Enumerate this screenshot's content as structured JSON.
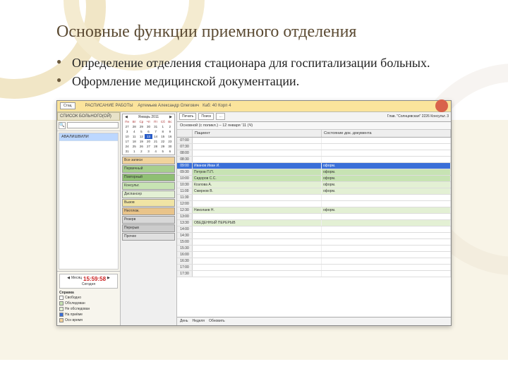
{
  "slide": {
    "title": "Основные функции приемного отделения",
    "bullets": [
      "Определение отделения стационара для госпитализации больных.",
      "Оформление медицинской документации."
    ]
  },
  "app": {
    "header": {
      "btn1": "Стац",
      "user_line1": "РАСПИСАНИЕ",
      "user_line2": "РАБОТЫ",
      "user_name": "Артемьев Александр Олегович",
      "user_id": "Каб: 40 Корп 4"
    },
    "left": {
      "panel_title": "СПИСОК БОЛЬНОГО(ОЙ)",
      "search_placeholder": "",
      "patient": "АВАЛИШВИЛИ",
      "clock_label": "Месяц",
      "clock_time": "15:59:58",
      "clock_day": "Сегодня",
      "legend_title": "Справка",
      "legend": [
        {
          "label": "Свободно",
          "color": "#ffffff"
        },
        {
          "label": "Обследован",
          "color": "#c7e3b3"
        },
        {
          "label": "Не обследован",
          "color": "#e3f0d4"
        },
        {
          "label": "На приёме",
          "color": "#3a6fd8"
        },
        {
          "label": "Осн время",
          "color": "#f6d39a"
        }
      ]
    },
    "calendar": {
      "month": "Январь 2011",
      "dow": [
        "Пн",
        "Вт",
        "Ср",
        "Чт",
        "Пт",
        "Сб",
        "Вс"
      ],
      "days": [
        "27",
        "28",
        "29",
        "30",
        "31",
        "1",
        "2",
        "3",
        "4",
        "5",
        "6",
        "7",
        "8",
        "9",
        "10",
        "11",
        "12",
        "13",
        "14",
        "15",
        "16",
        "17",
        "18",
        "19",
        "20",
        "21",
        "22",
        "23",
        "24",
        "25",
        "26",
        "27",
        "28",
        "29",
        "30",
        "31",
        "1",
        "2",
        "3",
        "4",
        "5",
        "6"
      ],
      "selected": "13"
    },
    "categories": [
      {
        "label": "Все записи",
        "color": "#f1d39c"
      },
      {
        "label": "Первичный",
        "color": "#a7cf8d"
      },
      {
        "label": "Повторный",
        "color": "#8fbf73"
      },
      {
        "label": "Консульт.",
        "color": "#c7e3b3"
      },
      {
        "label": "Диспансер",
        "color": "#e3f0d4"
      },
      {
        "label": "Вызов",
        "color": "#f0e4a4"
      },
      {
        "label": "Неотлож.",
        "color": "#e9c48a"
      },
      {
        "label": "Резерв",
        "color": "#d8d8d8"
      },
      {
        "label": "Перерыв",
        "color": "#cccccc"
      },
      {
        "label": "Прочее",
        "color": "#e0e0e0"
      }
    ],
    "main": {
      "toolbar": [
        "Печать",
        "Поиск",
        "…"
      ],
      "title_row": "Глав. \"Солнцевская\" 2226  Консульт. 3",
      "day_label": "Основной (с поликл.) – 12 января ’11 (Ч)",
      "col1": "Пациент",
      "col2": "Состояние док. документа",
      "rows": [
        {
          "time": "07:00",
          "c1": "",
          "c2": "",
          "cls": ""
        },
        {
          "time": "07:30",
          "c1": "",
          "c2": "",
          "cls": ""
        },
        {
          "time": "08:00",
          "c1": "",
          "c2": "",
          "cls": ""
        },
        {
          "time": "08:30",
          "c1": "",
          "c2": "",
          "cls": "row-lightgreen"
        },
        {
          "time": "09:00",
          "c1": "Иванов Иван И.",
          "c2": "оформ.",
          "cls": "row-blue"
        },
        {
          "time": "09:30",
          "c1": "Петров П.П.",
          "c2": "оформ.",
          "cls": "row-green"
        },
        {
          "time": "10:00",
          "c1": "Сидоров С.С.",
          "c2": "оформ.",
          "cls": "row-green"
        },
        {
          "time": "10:30",
          "c1": "Козлова А.",
          "c2": "оформ.",
          "cls": "row-lgreen"
        },
        {
          "time": "11:00",
          "c1": "Смирнов В.",
          "c2": "оформ.",
          "cls": "row-lgreen"
        },
        {
          "time": "11:30",
          "c1": "",
          "c2": "",
          "cls": ""
        },
        {
          "time": "12:00",
          "c1": "",
          "c2": "",
          "cls": "row-lightgreen"
        },
        {
          "time": "12:30",
          "c1": "Николаев Н.",
          "c2": "оформ.",
          "cls": "row-lgreen"
        },
        {
          "time": "13:00",
          "c1": "",
          "c2": "",
          "cls": ""
        },
        {
          "time": "13:30",
          "c1": "ОБЕДЕННЫЙ ПЕРЕРЫВ",
          "c2": "",
          "cls": "row-lgreen"
        },
        {
          "time": "14:00",
          "c1": "",
          "c2": "",
          "cls": ""
        },
        {
          "time": "14:30",
          "c1": "",
          "c2": "",
          "cls": ""
        },
        {
          "time": "15:00",
          "c1": "",
          "c2": "",
          "cls": ""
        },
        {
          "time": "15:30",
          "c1": "",
          "c2": "",
          "cls": ""
        },
        {
          "time": "16:00",
          "c1": "",
          "c2": "",
          "cls": ""
        },
        {
          "time": "16:30",
          "c1": "",
          "c2": "",
          "cls": ""
        },
        {
          "time": "17:00",
          "c1": "",
          "c2": "",
          "cls": ""
        },
        {
          "time": "17:30",
          "c1": "",
          "c2": "",
          "cls": ""
        }
      ],
      "footer": [
        "День",
        "Неделя",
        "Обновить"
      ]
    }
  }
}
